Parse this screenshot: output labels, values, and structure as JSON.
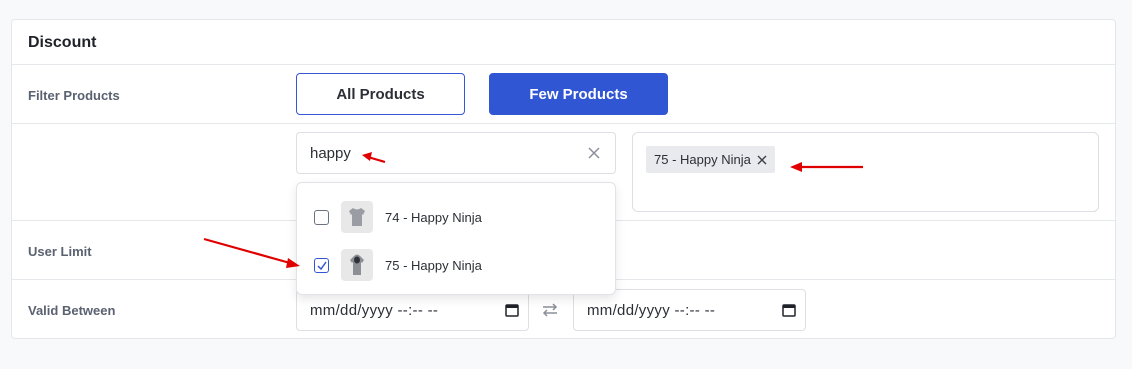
{
  "card": {
    "title": "Discount"
  },
  "rows": {
    "filter_products": "Filter Products",
    "user_limit": "User Limit",
    "valid_between": "Valid Between"
  },
  "filter_buttons": {
    "all": "All Products",
    "few": "Few Products"
  },
  "search": {
    "value": "happy",
    "clear_icon": "close-icon"
  },
  "selected_tags": [
    {
      "label": "75 - Happy Ninja"
    }
  ],
  "dropdown": {
    "options": [
      {
        "label": "74 - Happy Ninja",
        "checked": false,
        "icon": "tshirt-icon"
      },
      {
        "label": "75 - Happy Ninja",
        "checked": true,
        "icon": "hoodie-icon"
      }
    ]
  },
  "dates": {
    "start_placeholder": "mm/dd/yyyy --:-- --",
    "end_placeholder": "mm/dd/yyyy --:-- --"
  },
  "colors": {
    "primary": "#3156d3",
    "annotation_arrow": "#e00000"
  }
}
